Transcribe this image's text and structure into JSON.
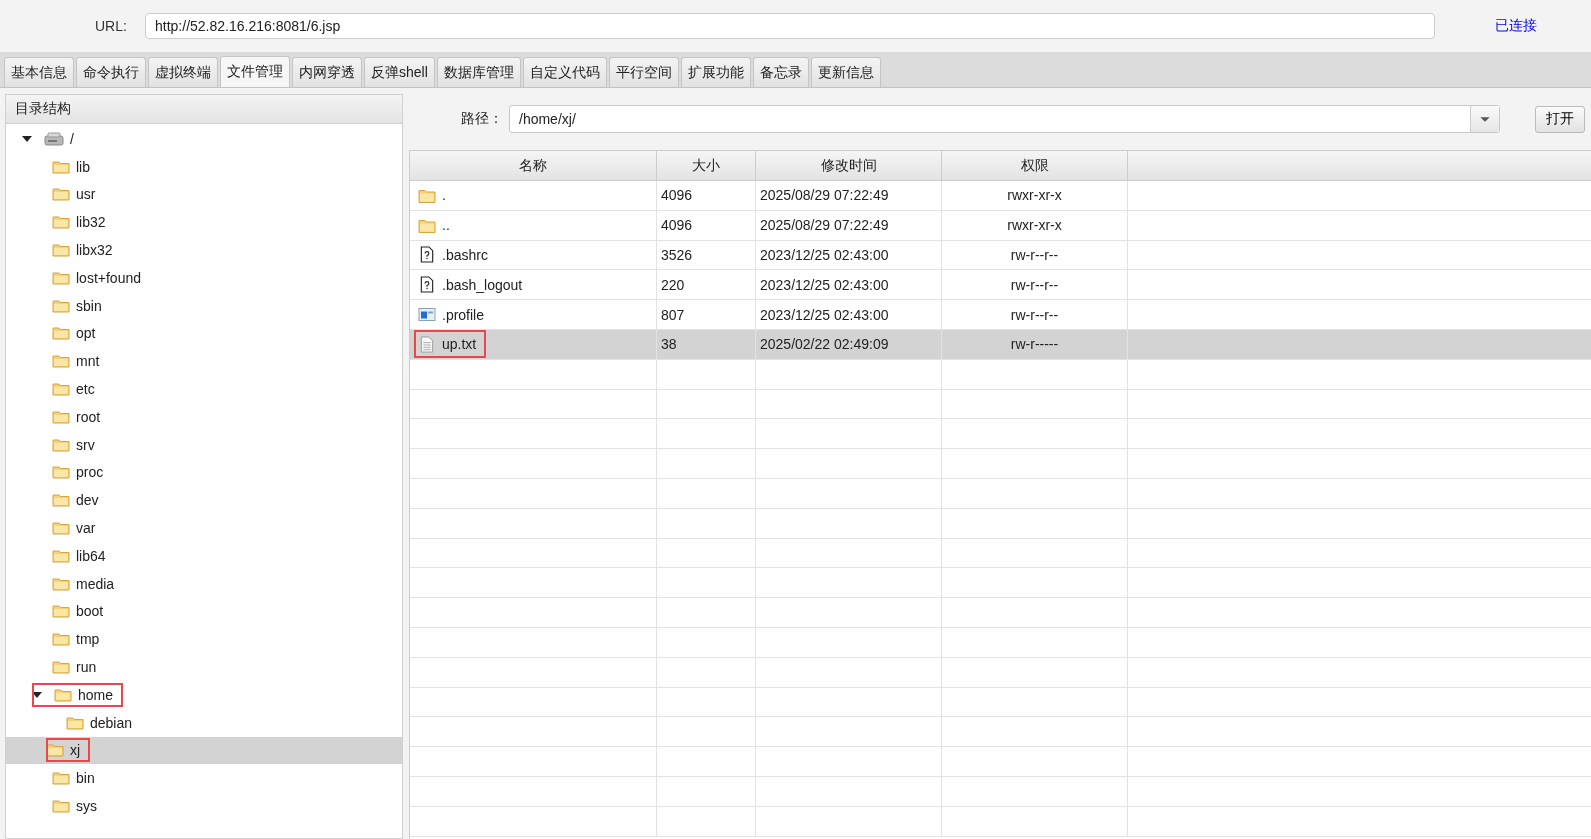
{
  "url_bar": {
    "label": "URL:",
    "value": "http://52.82.16.216:8081/6.jsp",
    "status": "已连接"
  },
  "tabs": [
    {
      "label": "基本信息",
      "selected": false
    },
    {
      "label": "命令执行",
      "selected": false
    },
    {
      "label": "虚拟终端",
      "selected": false
    },
    {
      "label": "文件管理",
      "selected": true
    },
    {
      "label": "内网穿透",
      "selected": false
    },
    {
      "label": "反弹shell",
      "selected": false
    },
    {
      "label": "数据库管理",
      "selected": false
    },
    {
      "label": "自定义代码",
      "selected": false
    },
    {
      "label": "平行空间",
      "selected": false
    },
    {
      "label": "扩展功能",
      "selected": false
    },
    {
      "label": "备忘录",
      "selected": false
    },
    {
      "label": "更新信息",
      "selected": false
    }
  ],
  "tree": {
    "title": "目录结构",
    "items": [
      {
        "name": "/",
        "kind": "drive",
        "expanded": true,
        "selected": false,
        "annotated": false,
        "children": [
          {
            "name": "lib",
            "kind": "folder",
            "selected": false,
            "annotated": false
          },
          {
            "name": "usr",
            "kind": "folder",
            "selected": false,
            "annotated": false
          },
          {
            "name": "lib32",
            "kind": "folder",
            "selected": false,
            "annotated": false
          },
          {
            "name": "libx32",
            "kind": "folder",
            "selected": false,
            "annotated": false
          },
          {
            "name": "lost+found",
            "kind": "folder",
            "selected": false,
            "annotated": false
          },
          {
            "name": "sbin",
            "kind": "folder",
            "selected": false,
            "annotated": false
          },
          {
            "name": "opt",
            "kind": "folder",
            "selected": false,
            "annotated": false
          },
          {
            "name": "mnt",
            "kind": "folder",
            "selected": false,
            "annotated": false
          },
          {
            "name": "etc",
            "kind": "folder",
            "selected": false,
            "annotated": false
          },
          {
            "name": "root",
            "kind": "folder",
            "selected": false,
            "annotated": false
          },
          {
            "name": "srv",
            "kind": "folder",
            "selected": false,
            "annotated": false
          },
          {
            "name": "proc",
            "kind": "folder",
            "selected": false,
            "annotated": false
          },
          {
            "name": "dev",
            "kind": "folder",
            "selected": false,
            "annotated": false
          },
          {
            "name": "var",
            "kind": "folder",
            "selected": false,
            "annotated": false
          },
          {
            "name": "lib64",
            "kind": "folder",
            "selected": false,
            "annotated": false
          },
          {
            "name": "media",
            "kind": "folder",
            "selected": false,
            "annotated": false
          },
          {
            "name": "boot",
            "kind": "folder",
            "selected": false,
            "annotated": false
          },
          {
            "name": "tmp",
            "kind": "folder",
            "selected": false,
            "annotated": false
          },
          {
            "name": "run",
            "kind": "folder",
            "selected": false,
            "annotated": false
          },
          {
            "name": "home",
            "kind": "folder",
            "expanded": true,
            "selected": false,
            "annotated": true,
            "children": [
              {
                "name": "debian",
                "kind": "folder",
                "selected": false,
                "annotated": false
              },
              {
                "name": "xj",
                "kind": "folder",
                "selected": true,
                "annotated": true
              }
            ]
          },
          {
            "name": "bin",
            "kind": "folder",
            "selected": false,
            "annotated": false
          },
          {
            "name": "sys",
            "kind": "folder",
            "selected": false,
            "annotated": false
          }
        ]
      }
    ]
  },
  "path_bar": {
    "label": "路径：",
    "value": "/home/xj/",
    "open_button": "打开"
  },
  "table": {
    "columns": [
      "名称",
      "大小",
      "修改时间",
      "权限"
    ],
    "rows": [
      {
        "name": ".",
        "kind": "folder",
        "size": "4096",
        "modified": "2025/08/29 07:22:49",
        "permissions": "rwxr-xr-x",
        "selected": false,
        "annotated": false
      },
      {
        "name": "..",
        "kind": "folder",
        "size": "4096",
        "modified": "2025/08/29 07:22:49",
        "permissions": "rwxr-xr-x",
        "selected": false,
        "annotated": false
      },
      {
        "name": ".bashrc",
        "kind": "unknown",
        "size": "3526",
        "modified": "2023/12/25 02:43:00",
        "permissions": "rw-r--r--",
        "selected": false,
        "annotated": false
      },
      {
        "name": ".bash_logout",
        "kind": "unknown",
        "size": "220",
        "modified": "2023/12/25 02:43:00",
        "permissions": "rw-r--r--",
        "selected": false,
        "annotated": false
      },
      {
        "name": ".profile",
        "kind": "app",
        "size": "807",
        "modified": "2023/12/25 02:43:00",
        "permissions": "rw-r--r--",
        "selected": false,
        "annotated": false
      },
      {
        "name": "up.txt",
        "kind": "text",
        "size": "38",
        "modified": "2025/02/22 02:49:09",
        "permissions": "rw-r-----",
        "selected": true,
        "annotated": true
      }
    ]
  }
}
